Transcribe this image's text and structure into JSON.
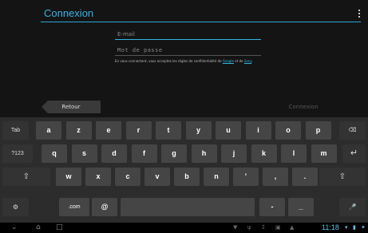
{
  "header": {
    "title": "Connexion",
    "menu_icon": "overflow-menu-icon"
  },
  "form": {
    "email_placeholder": "E-mail",
    "password_placeholder": "Mot de passe",
    "legal_text_before": "En vous connectant, vous acceptez les règles de confidentialité de ",
    "legal_link_1": "Google",
    "legal_text_middle": " et de ",
    "legal_link_2": "Sony",
    "legal_text_after": "."
  },
  "nav": {
    "back_label": "Retour",
    "connect_label": "Connexion"
  },
  "keyboard": {
    "row1": {
      "tab": "Tab",
      "keys": [
        "a",
        "z",
        "e",
        "r",
        "t",
        "y",
        "u",
        "i",
        "o",
        "p"
      ],
      "backspace": "⌫"
    },
    "row2": {
      "symbols": "?123",
      "keys": [
        "q",
        "s",
        "d",
        "f",
        "g",
        "h",
        "j",
        "k",
        "l",
        "m"
      ],
      "enter": "↵"
    },
    "row3": {
      "shift": "⇧",
      "keys": [
        "w",
        "x",
        "c",
        "v",
        "b",
        "n",
        "'",
        ",",
        "."
      ],
      "shift_right": "⇧"
    },
    "row4": {
      "settings": "⚙",
      "dotcom": ".com",
      "at": "@",
      "dash": "-",
      "underscore": "_",
      "mic": "🎤"
    }
  },
  "system_bar": {
    "clock": "11:18",
    "colors": {
      "accent": "#33b5e5"
    }
  }
}
